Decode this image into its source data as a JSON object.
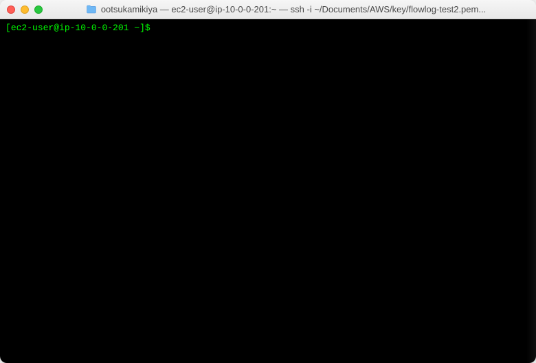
{
  "window": {
    "title": "ootsukamikiya — ec2-user@ip-10-0-0-201:~ — ssh -i ~/Documents/AWS/key/flowlog-test2.pem...",
    "folder_icon_label": "folder"
  },
  "terminal": {
    "prompt": {
      "open_bracket": "[",
      "user": "ec2-user",
      "at": "@",
      "host": "ip-10-0-0-201",
      "path": " ~",
      "close_bracket": "]",
      "symbol": "$"
    }
  },
  "colors": {
    "prompt_green": "#00ff00",
    "terminal_bg": "#000000",
    "traffic_red": "#ff5f57",
    "traffic_yellow": "#febc2e",
    "traffic_green": "#28c840"
  }
}
